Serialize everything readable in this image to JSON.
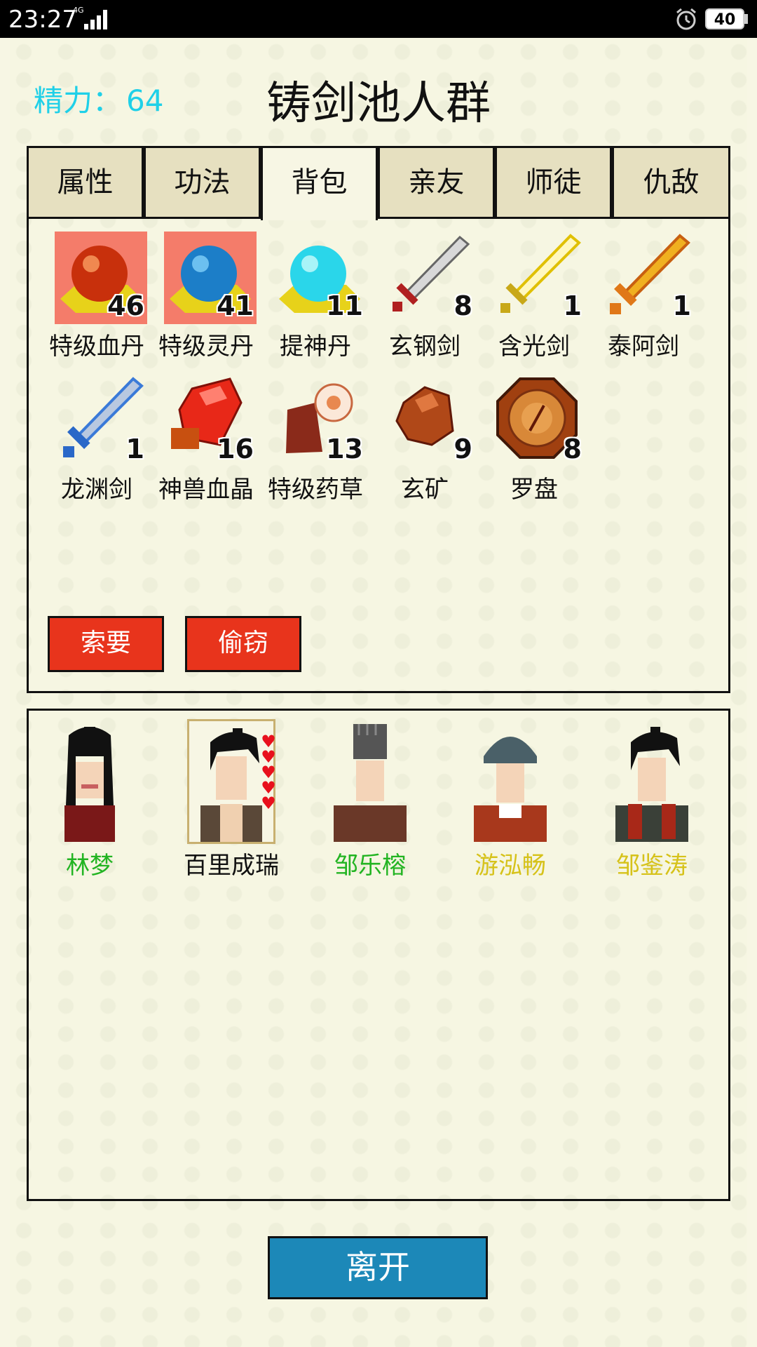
{
  "status_bar": {
    "time": "23:27",
    "network": "4G",
    "battery": "40"
  },
  "header": {
    "energy_label": "精力：",
    "energy_value": "64",
    "title": "铸剑池人群"
  },
  "tabs": [
    {
      "label": "属性",
      "active": false
    },
    {
      "label": "功法",
      "active": false
    },
    {
      "label": "背包",
      "active": true
    },
    {
      "label": "亲友",
      "active": false
    },
    {
      "label": "师徒",
      "active": false
    },
    {
      "label": "仇敌",
      "active": false
    }
  ],
  "items": [
    {
      "name": "特级血丹",
      "count": "46",
      "icon": "red-pill-icon"
    },
    {
      "name": "特级灵丹",
      "count": "41",
      "icon": "blue-pill-icon"
    },
    {
      "name": "提神丹",
      "count": "11",
      "icon": "cyan-pill-icon"
    },
    {
      "name": "玄钢剑",
      "count": "8",
      "icon": "steel-sword-icon"
    },
    {
      "name": "含光剑",
      "count": "1",
      "icon": "light-sword-icon"
    },
    {
      "name": "泰阿剑",
      "count": "1",
      "icon": "golden-sword-icon"
    },
    {
      "name": "龙渊剑",
      "count": "1",
      "icon": "blue-sword-icon"
    },
    {
      "name": "神兽血晶",
      "count": "16",
      "icon": "blood-crystal-icon"
    },
    {
      "name": "特级药草",
      "count": "13",
      "icon": "herb-icon"
    },
    {
      "name": "玄矿",
      "count": "9",
      "icon": "ore-icon"
    },
    {
      "name": "罗盘",
      "count": "8",
      "icon": "compass-icon"
    }
  ],
  "actions": {
    "demand": "索要",
    "steal": "偷窃"
  },
  "npcs": [
    {
      "name": "林梦",
      "color": "#22b422",
      "selected": false
    },
    {
      "name": "百里成瑞",
      "color": "#111111",
      "selected": true,
      "hearts": 5
    },
    {
      "name": "邹乐榕",
      "color": "#22b422",
      "selected": false
    },
    {
      "name": "游泓畅",
      "color": "#d6c21a",
      "selected": false
    },
    {
      "name": "邹鉴涛",
      "color": "#d6c21a",
      "selected": false
    }
  ],
  "leave_label": "离开"
}
